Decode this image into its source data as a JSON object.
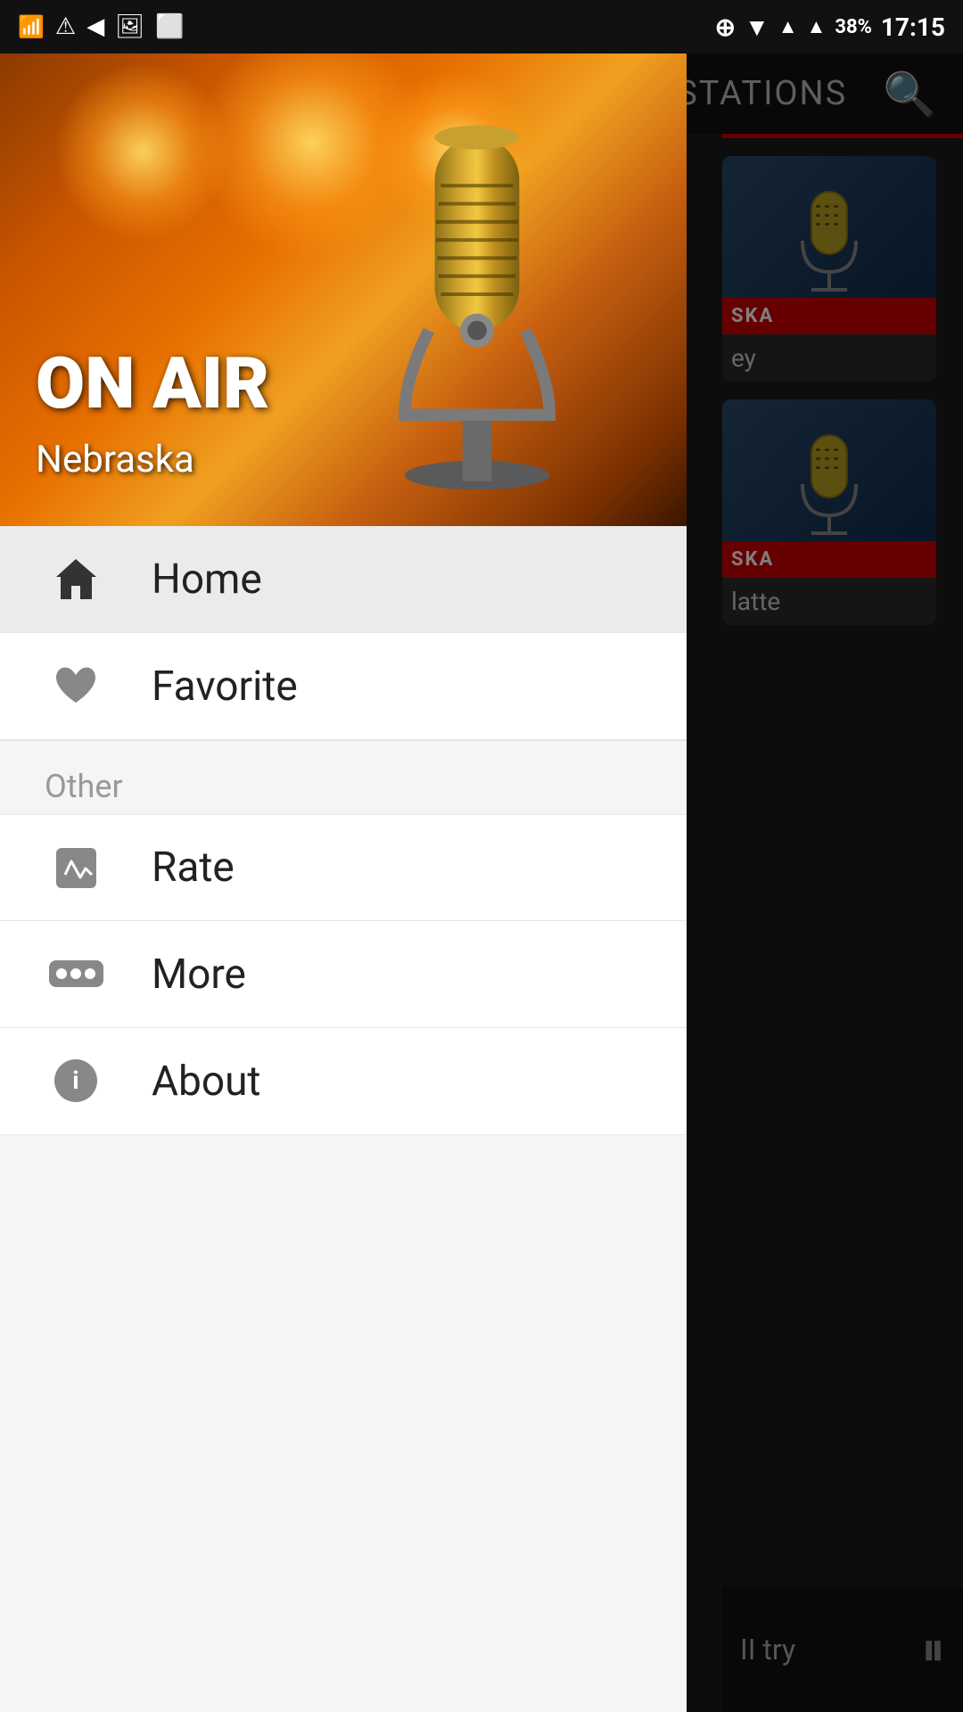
{
  "statusBar": {
    "time": "17:15",
    "battery": "38%"
  },
  "hero": {
    "onAirText": "ON\nAIR",
    "stationName": "Nebraska"
  },
  "drawer": {
    "mainNav": [
      {
        "id": "home",
        "label": "Home",
        "icon": "home"
      },
      {
        "id": "favorite",
        "label": "Favorite",
        "icon": "heart"
      }
    ],
    "sectionHeader": "Other",
    "otherNav": [
      {
        "id": "rate",
        "label": "Rate",
        "icon": "pencil"
      },
      {
        "id": "more",
        "label": "More",
        "icon": "dots"
      },
      {
        "id": "about",
        "label": "About",
        "icon": "info"
      }
    ]
  },
  "mainContent": {
    "tabLabel": "STATIONS",
    "stationCards": [
      {
        "badge": "SKA",
        "name": "ey"
      },
      {
        "badge": "SKA",
        "name": "latte"
      }
    ]
  },
  "playerBar": {
    "text": "II try"
  }
}
